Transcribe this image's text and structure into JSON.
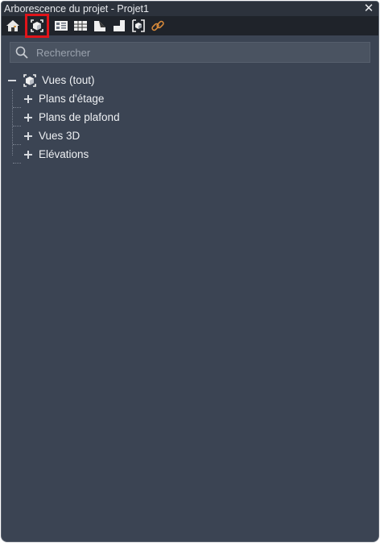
{
  "window": {
    "title": "Arborescence du projet - Projet1",
    "close_symbol": "✕"
  },
  "toolbar": {
    "buttons": [
      {
        "icon": "home-icon"
      },
      {
        "icon": "views-icon",
        "selected": true
      },
      {
        "icon": "sheets-icon"
      },
      {
        "icon": "schedules-icon"
      },
      {
        "icon": "families-icon"
      },
      {
        "icon": "groups-icon"
      },
      {
        "icon": "3d-view-icon"
      },
      {
        "icon": "links-icon"
      }
    ],
    "selected_color": "#e0141a"
  },
  "search": {
    "placeholder": "Rechercher",
    "value": ""
  },
  "tree": {
    "root": {
      "label": "Vues (tout)",
      "expanded": true
    },
    "children": [
      {
        "label": "Plans d'étage"
      },
      {
        "label": "Plans de plafond"
      },
      {
        "label": "Vues 3D"
      },
      {
        "label": "Elévations"
      }
    ]
  }
}
